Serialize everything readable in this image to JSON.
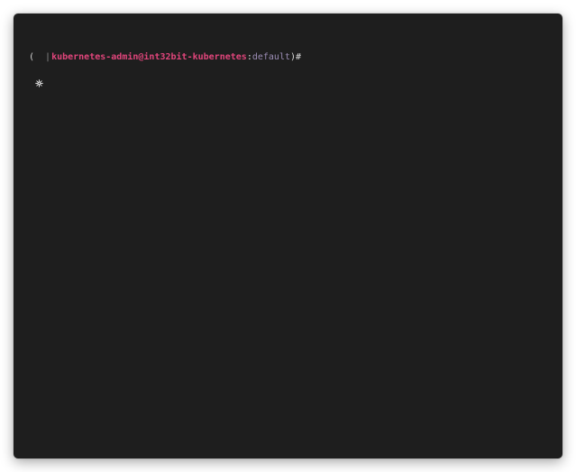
{
  "prompt": {
    "open_paren": "(",
    "icon": "kubernetes-helm-icon",
    "separator": "|",
    "context": "kubernetes-admin@int32bit-kubernetes",
    "colon": ":",
    "namespace": "default",
    "close": ")#"
  },
  "colors": {
    "background": "#1e1e1e",
    "context": "#e0457b",
    "namespace": "#9c8db5"
  }
}
